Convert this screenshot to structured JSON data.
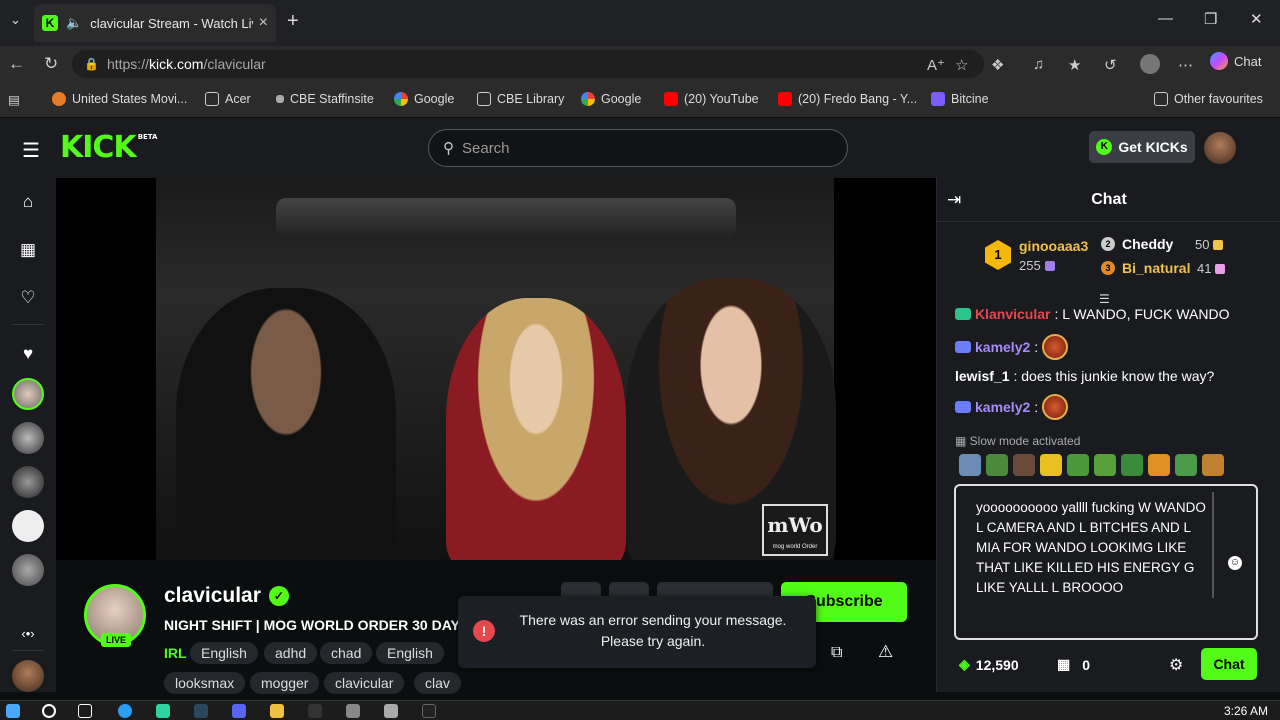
{
  "browser": {
    "tab_title": "clavicular Stream - Watch Live",
    "tab_favicon_letter": "K",
    "url_prefix": "https://",
    "url_host": "kick.com",
    "url_path": "/clavicular",
    "copilot_label": "Chat",
    "bookmarks": [
      "United States Movi...",
      "Acer",
      "CBE Staffinsite",
      "Google",
      "CBE Library",
      "Google",
      "(20) YouTube",
      "(20) Fredo Bang - Y...",
      "Bitcine"
    ],
    "other_favourites": "Other favourites"
  },
  "kick": {
    "logo_text": "KICK",
    "logo_beta": "BETA",
    "search_placeholder": "Search",
    "get_kicks_label": "Get KICKs"
  },
  "video": {
    "watermark_text": "mWo",
    "watermark_sub": "mog world Order"
  },
  "channel": {
    "name": "clavicular",
    "live_label": "LIVE",
    "stream_title": "NIGHT SHIFT | MOG WORLD ORDER 30 DAY",
    "category": "IRL",
    "tags": [
      "English",
      "adhd",
      "chad",
      "English",
      "looksmax",
      "mogger",
      "clavicular",
      "clav"
    ],
    "subscribe_label": "Subscribe"
  },
  "toast": {
    "line1": "There was an error sending your message.",
    "line2": "Please try again."
  },
  "chat": {
    "title": "Chat",
    "leaderboard": {
      "first": {
        "rank": "1",
        "name": "ginooaaa3",
        "value": "255"
      },
      "second": {
        "rank": "2",
        "name": "Cheddy",
        "value": "50"
      },
      "third": {
        "rank": "3",
        "name": "Bi_natural",
        "value": "41"
      }
    },
    "messages": [
      {
        "user": "Klanvicular",
        "text": ": L WANDO, FUCK WANDO",
        "color": "#e5484d"
      },
      {
        "user": "kamely2",
        "text": ":",
        "color": "#a78bfa"
      },
      {
        "user": "lewisf_1",
        "text": ": does this junkie know the way?",
        "color": "#ffffff"
      },
      {
        "user": "kamely2",
        "text": ":",
        "color": "#a78bfa"
      }
    ],
    "slow_mode": "Slow mode activated",
    "input_text": "yoooooooooo yallll fucking W WANDO L CAMERA AND L BITCHES AND L MIA FOR WANDO LOOKIMG LIKE THAT LIKE KILLED HIS ENERGY G LIKE YALLL L BROOOO",
    "points": "12,590",
    "box_count": "0",
    "send_label": "Chat"
  },
  "taskbar": {
    "clock": "3:26 AM"
  },
  "colors": {
    "accent": "#53fc18",
    "gold": "#f5b70a",
    "leader_name": "#f0c14b",
    "error": "#e5484d"
  }
}
